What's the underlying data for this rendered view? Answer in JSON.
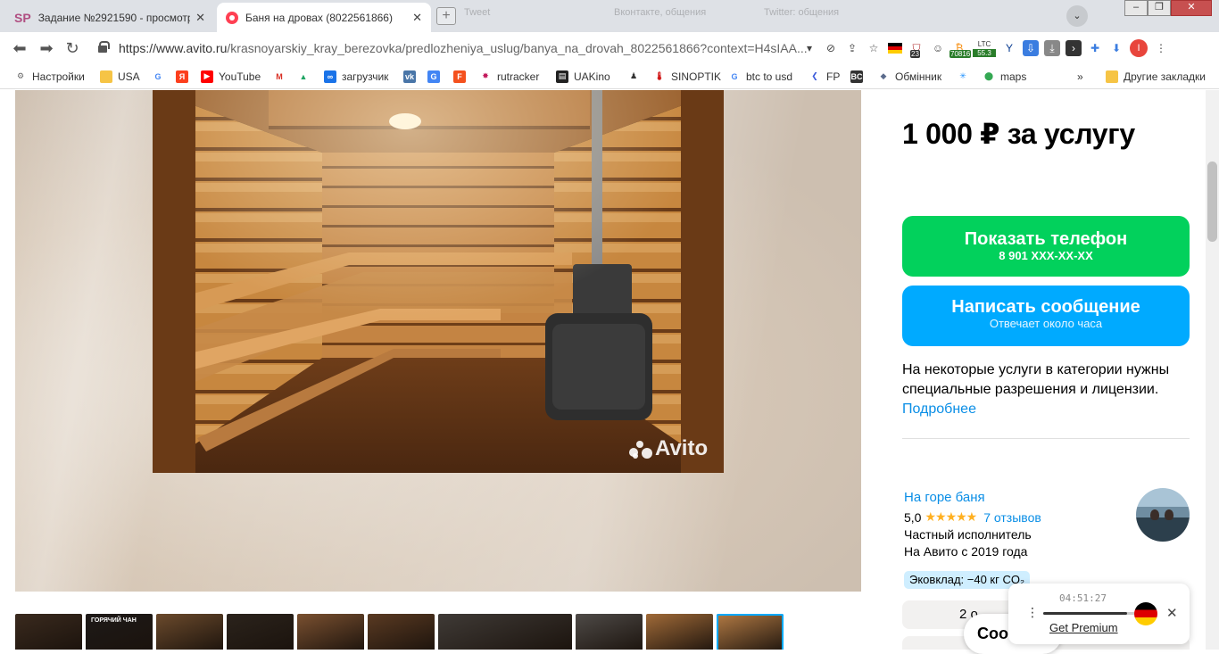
{
  "browser": {
    "tabs": [
      {
        "favicon": "SP",
        "title": "Задание №2921590 - просмотр з"
      },
      {
        "title": "Баня на дровах (8022561866)"
      }
    ],
    "ghost_tabs": [
      "Tweet",
      "Вконтакте, общения",
      "Twitter: общения"
    ],
    "address": {
      "host": "https://www.avito.ru",
      "path": "/krasnoyarskiy_kray_berezovka/predlozheniya_uslug/banya_na_drovah_8022561866?context=H4sIAA..."
    },
    "extensions": {
      "badge_23": "23",
      "ltc_label": "LTC",
      "ltc_value": "55.3",
      "btc_value": "70816",
      "profile_initial": "I"
    },
    "bookmarks": [
      {
        "label": "Настройки",
        "icon": "gear-icon"
      },
      {
        "label": "USA",
        "icon": "folder-icon"
      },
      {
        "label": "",
        "icon": "google-icon"
      },
      {
        "label": "",
        "icon": "yandex-icon"
      },
      {
        "label": "YouTube",
        "icon": "youtube-icon"
      },
      {
        "label": "",
        "icon": "gmail-icon"
      },
      {
        "label": "",
        "icon": "drive-icon"
      },
      {
        "label": "загрузчик",
        "icon": "loop-icon"
      },
      {
        "label": "",
        "icon": "vk-icon"
      },
      {
        "label": "",
        "icon": "translate-icon"
      },
      {
        "label": "",
        "icon": "f-icon"
      },
      {
        "label": "rutracker",
        "icon": "rutracker-icon"
      },
      {
        "label": "UAKino",
        "icon": "uakino-icon"
      },
      {
        "label": "",
        "icon": "person-icon"
      },
      {
        "label": "SINOPTIK",
        "icon": "thermometer-icon"
      },
      {
        "label": "btc to usd",
        "icon": "google-icon"
      },
      {
        "label": "FP",
        "icon": "fp-icon"
      },
      {
        "label": "",
        "icon": "bc-icon"
      },
      {
        "label": "Обмінник",
        "icon": "exchange-icon"
      },
      {
        "label": "",
        "icon": "star-icon"
      },
      {
        "label": "maps",
        "icon": "maps-icon"
      }
    ],
    "bookmarks_more": "»",
    "other_bookmarks": "Другие закладки"
  },
  "listing": {
    "price": "1 000 ₽ за услугу",
    "watermark": "Avito",
    "thumbnail_text": "ГОРЯЧИЙ ЧАН",
    "thumbnail_count": 10,
    "active_thumbnail": 9,
    "phone_button": {
      "label": "Показать телефон",
      "number": "8 901 XXX-XX-XX"
    },
    "message_button": {
      "label": "Написать сообщение",
      "sub": "Отвечает около часа"
    },
    "notice": "На некоторые услуги в категории нужны специальные разрешения и лицензии.",
    "notice_link": "Подробнее"
  },
  "seller": {
    "name": "На горе баня",
    "rating": "5,0",
    "stars": "★★★★★",
    "reviews": "7 отзывов",
    "type": "Частный исполнитель",
    "since": "На Авито с 2019 года",
    "eco": "Эковклад: −40 кг CO₂",
    "more_button": "2 о"
  },
  "overlay": {
    "chat_label": "Соо",
    "time": "04:51:27",
    "progress": 0.76,
    "premium": "Get Premium"
  },
  "colors": {
    "phone_green": "#02d15c",
    "message_blue": "#00aaff",
    "link_blue": "#0a8ee6",
    "star_gold": "#ffb021"
  }
}
